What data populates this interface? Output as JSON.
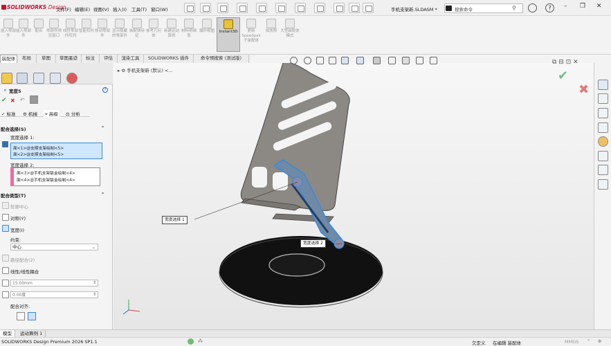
{
  "app": {
    "brand": "SOLIDWORKS",
    "brand_suffix": "Design",
    "document_name": "手机支架新.SLDASM *"
  },
  "menu": [
    "文件(F)",
    "编辑(E)",
    "视图(V)",
    "插入(I)",
    "工具(T)",
    "窗口(W)"
  ],
  "search": {
    "placeholder": "搜索命令"
  },
  "ribbon": [
    {
      "label": "插入零部件"
    },
    {
      "label": "插入零部件"
    },
    {
      "label": "配合"
    },
    {
      "label": "零部件预览窗口"
    },
    {
      "label": "线性零部件阵列"
    },
    {
      "label": "智能扣件"
    },
    {
      "label": "移动零部件"
    },
    {
      "label": "显示隐藏的零部件"
    },
    {
      "label": "装配体特征"
    },
    {
      "label": "参考几何体"
    },
    {
      "label": "新建运动算例"
    },
    {
      "label": "材料明细表"
    },
    {
      "label": "爆炸视图"
    },
    {
      "label": "Instant3D"
    },
    {
      "label": "更新 Speedpak 子装配体"
    },
    {
      "label": "拍快照"
    },
    {
      "label": "大型装配体模式"
    }
  ],
  "tabs": [
    "装配体",
    "布局",
    "草图",
    "草图墨迹",
    "标注",
    "评估",
    "渲染工具",
    "SOLIDWORKS 插件",
    "命令预搜索 (测试版)"
  ],
  "tree_breadcrumb": "手机支架新 (默认) <...",
  "panel": {
    "title": "宽度5",
    "subtabs": [
      "标准",
      "机械",
      "高级",
      "分析"
    ],
    "selections_header": "配合选择(S)",
    "width_selection_label": "宽度选择 1:",
    "width_selection_items": [
      "面<1>@支撑支架绘制<5>",
      "面<2>@支撑支架绘制<5>"
    ],
    "tab_selection_label": "宽度选择 2:",
    "tab_selection_items": [
      "面<3>@手机支架钣金绘制<4>",
      "面<4>@手机支架钣金绘制<4>"
    ],
    "mate_types_header": "配合类型(T)",
    "profile_center": "轮廓中心",
    "symmetric": "对称(Y)",
    "width": "宽度(I)",
    "constraint_label": "约束:",
    "constraint_value": "中心",
    "path_mate": "路径配合(2)",
    "linear_coupler": "线性/线性耦合",
    "distance_value": "15.00mm",
    "angle_value": "0.00度",
    "alignment_label": "配合对齐:"
  },
  "callouts": {
    "first": "宽度选择 1",
    "second": "宽度选择 2"
  },
  "bottom_tabs": [
    "模型",
    "运动算例 1"
  ],
  "status": {
    "product": "SOLIDWORKS Design Premium 2026 SP1.1",
    "state": "欠定义",
    "mode": "在编辑 装配体",
    "units": "MMGS"
  },
  "colors": {
    "accent": "#e8c23a",
    "selection": "#3a8ad8",
    "ok": "#3aa655",
    "cancel": "#d64545"
  }
}
